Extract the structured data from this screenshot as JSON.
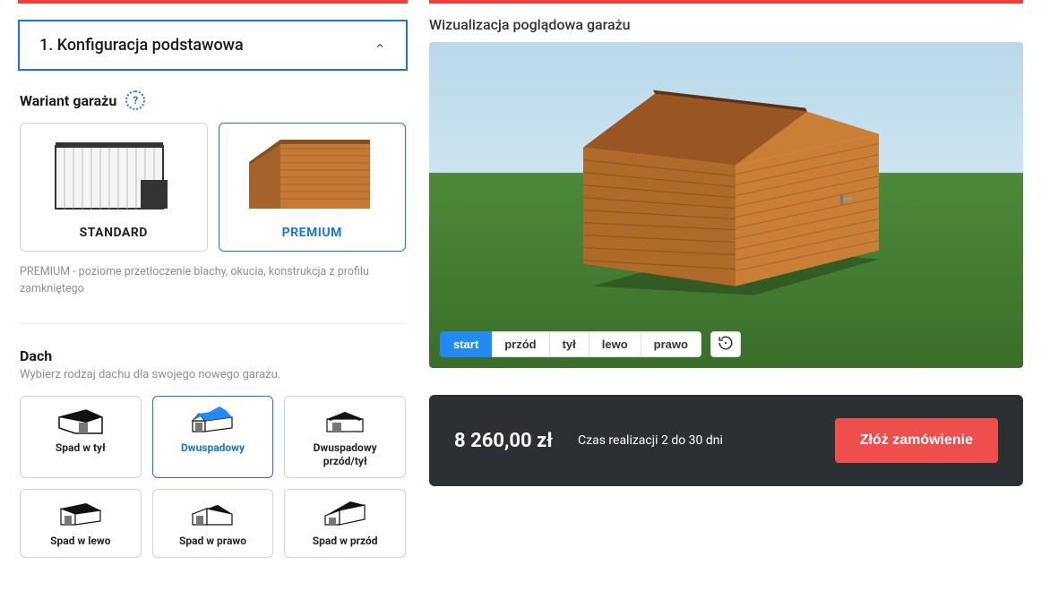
{
  "config": {
    "accordion_title": "1. Konfiguracja podstawowa",
    "variant": {
      "title": "Wariant garażu",
      "options": {
        "standard": "STANDARD",
        "premium": "PREMIUM"
      },
      "description": "PREMIUM - poziome przetłoczenie blachy, okucia, konstrukcja z profilu zamkniętego"
    },
    "roof": {
      "title": "Dach",
      "subtitle": "Wybierz rodzaj dachu dla swojego nowego garażu.",
      "options": {
        "back": "Spad w tył",
        "gable": "Dwuspadowy",
        "gable_fb": "Dwuspadowy przód/tył",
        "left": "Spad w lewo",
        "right": "Spad w prawo",
        "front": "Spad w przód"
      }
    }
  },
  "viz": {
    "title": "Wizualizacja poglądowa garażu",
    "buttons": {
      "start": "start",
      "front": "przód",
      "back": "tył",
      "left": "lewo",
      "right": "prawo"
    }
  },
  "summary": {
    "price": "8 260,00 zł",
    "lead_time": "Czas realizacji 2 do 30 dni",
    "order_button": "Złóż zamówienie"
  }
}
